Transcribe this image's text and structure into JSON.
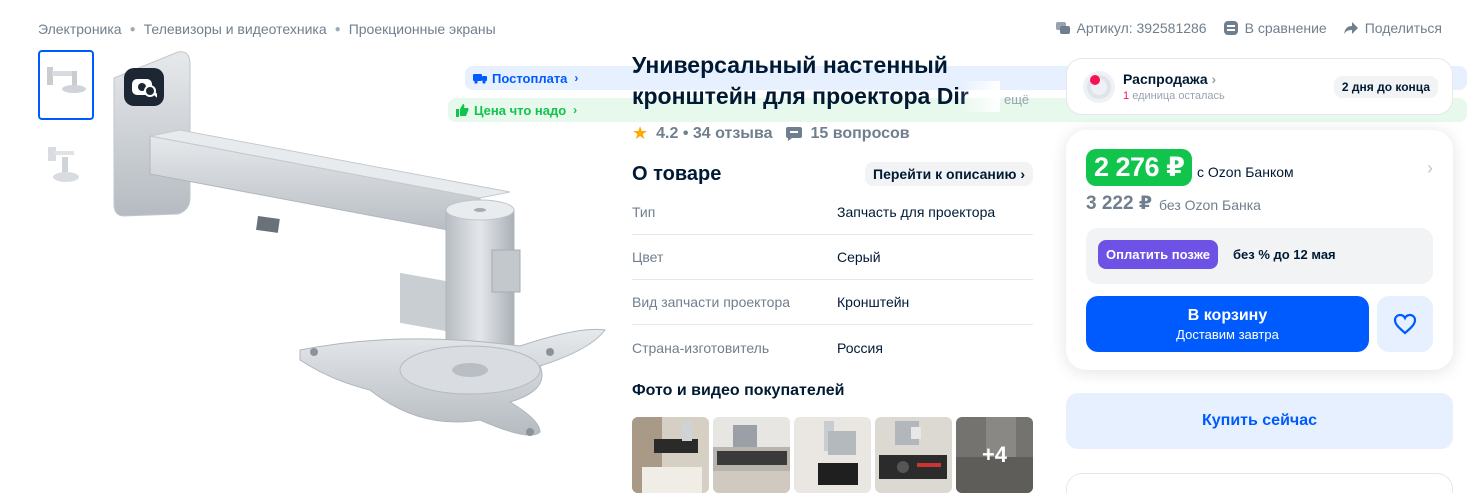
{
  "breadcrumbs": [
    "Электроника",
    "Телевизоры и видеотехника",
    "Проекционные экраны"
  ],
  "top_actions": {
    "article": "Артикул: 392581286",
    "compare": "В сравнение",
    "share": "Поделиться"
  },
  "gallery": {
    "badge_postpay": "Постоплата",
    "badge_price": "Цена что надо"
  },
  "product": {
    "title_line1": "Универсальный настенный",
    "title_line2": "кронштейн для проектора Dir",
    "more": "ещё",
    "rating": "4.2",
    "reviews": "34 отзыва",
    "questions": "15 вопросов"
  },
  "about": {
    "heading": "О товаре",
    "goto_label": "Перейти к описанию",
    "specs": [
      {
        "key": "Тип",
        "value": "Запчасть для проектора"
      },
      {
        "key": "Цвет",
        "value": "Серый"
      },
      {
        "key": "Вид запчасти проектора",
        "value": "Кронштейн"
      },
      {
        "key": "Страна-изготовитель",
        "value": "Россия"
      }
    ]
  },
  "photos": {
    "heading": "Фото и видео покупателей",
    "more_count": "+4"
  },
  "sale": {
    "title": "Распродажа",
    "units_count": "1",
    "units_text": "единица осталась",
    "days_left": "2 дня до конца"
  },
  "price": {
    "card_price": "2 276 ₽",
    "card_label": "с Ozon Банком",
    "regular_price": "3 222 ₽",
    "regular_label": "без Ozon Банка",
    "pay_later_button": "Оплатить позже",
    "pay_later_text": "без % до 12 мая",
    "cart_label": "В корзину",
    "cart_sub": "Доставим завтра",
    "buy_now": "Купить сейчас"
  },
  "colors": {
    "accent": "#005bff",
    "green": "#10c44c",
    "purple": "#6e52e5",
    "star": "#ffa800"
  }
}
